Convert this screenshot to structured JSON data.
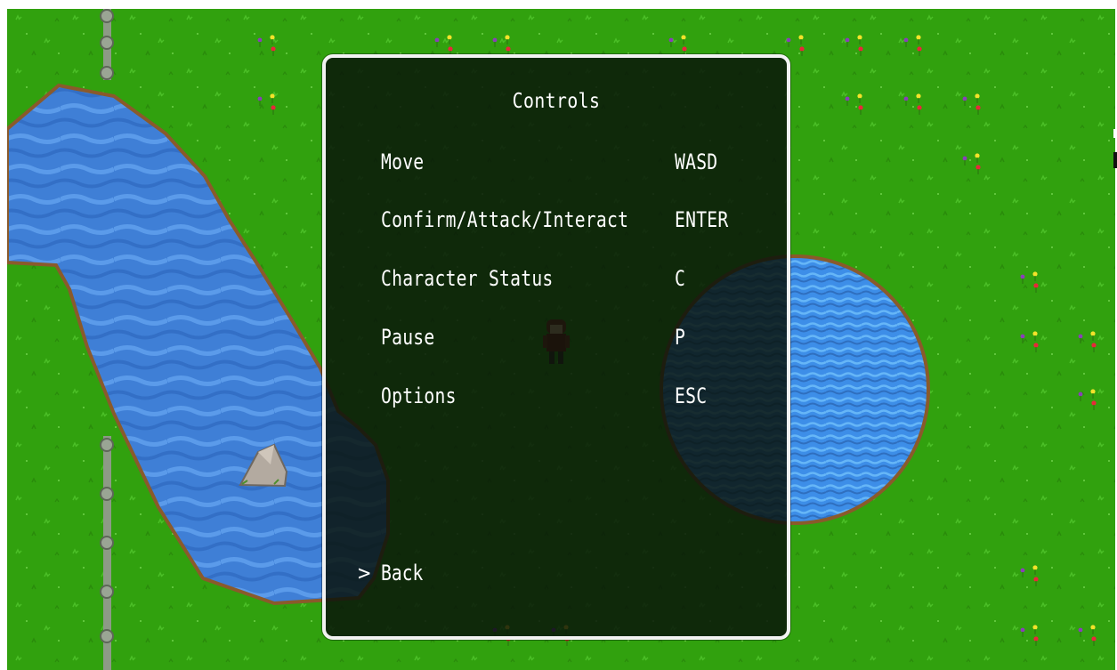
{
  "menu": {
    "title": "Controls",
    "rows": [
      {
        "action": "Move",
        "key": "WASD"
      },
      {
        "action": "Confirm/Attack/Interact",
        "key": "ENTER"
      },
      {
        "action": "Character Status",
        "key": "C"
      },
      {
        "action": "Pause",
        "key": "P"
      },
      {
        "action": "Options",
        "key": "ESC"
      }
    ],
    "cursor": ">",
    "back_label": "Back",
    "selected": "Back"
  },
  "colors": {
    "grass": "#31a10e",
    "water": "#3f7fd6",
    "bank": "#8a5a2b",
    "panel_border": "#f2f2f2",
    "text": "#ffffff"
  },
  "scene_objects": [
    "river",
    "pond",
    "rock",
    "stone-fence",
    "flowers",
    "player-character"
  ]
}
